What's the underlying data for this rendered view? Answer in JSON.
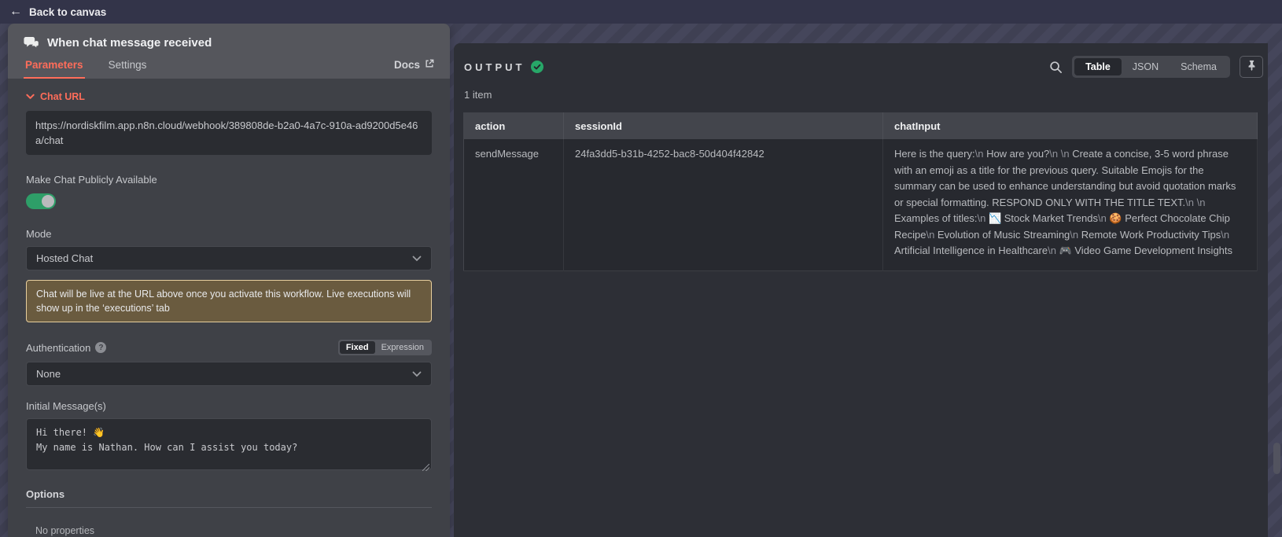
{
  "topbar": {
    "back_label": "Back to canvas"
  },
  "node_panel": {
    "title": "When chat message received",
    "tabs": {
      "parameters": "Parameters",
      "settings": "Settings"
    },
    "docs_label": "Docs",
    "chat_url": {
      "label": "Chat URL",
      "value": "https://nordiskfilm.app.n8n.cloud/webhook/389808de-b2a0-4a7c-910a-ad9200d5e46a/chat"
    },
    "public_available": {
      "label": "Make Chat Publicly Available",
      "state": "on"
    },
    "mode": {
      "label": "Mode",
      "value": "Hosted Chat"
    },
    "notice_text": "Chat will be live at the URL above once you activate this workflow. Live executions will show up in the ‘executions’ tab",
    "authentication": {
      "label": "Authentication",
      "value": "None"
    },
    "param_mode_toggle": {
      "fixed": "Fixed",
      "expression": "Expression",
      "active": "Fixed"
    },
    "initial_messages": {
      "label": "Initial Message(s)",
      "value": "Hi there! 👋\nMy name is Nathan. How can I assist you today?"
    },
    "options": {
      "label": "Options",
      "empty_text": "No properties"
    }
  },
  "output_panel": {
    "title": "OUTPUT",
    "status": "success",
    "items_count": "1 item",
    "view_tabs": {
      "table": "Table",
      "json": "JSON",
      "schema": "Schema",
      "active": "Table"
    },
    "table": {
      "columns": [
        "action",
        "sessionId",
        "chatInput"
      ],
      "rows": [
        {
          "action": "sendMessage",
          "sessionId": "24fa3dd5-b31b-4252-bac8-50d404f42842",
          "chatInput": "Here is the query:\\n How are you?\\n \\n Create a concise, 3-5 word phrase with an emoji as a title for the previous query. Suitable Emojis for the summary can be used to enhance understanding but avoid quotation marks or special formatting. RESPOND ONLY WITH THE TITLE TEXT.\\n \\n Examples of titles:\\n 📉 Stock Market Trends\\n 🍪 Perfect Chocolate Chip Recipe\\n Evolution of Music Streaming\\n Remote Work Productivity Tips\\n Artificial Intelligence in Healthcare\\n 🎮 Video Game Development Insights"
        }
      ]
    }
  },
  "colors": {
    "accent_orange": "#ff6d5a",
    "toggle_green": "#2e9e68",
    "success_green": "#27a768",
    "notice_bg": "#6a5b3f",
    "notice_border": "#e8cf9e"
  }
}
